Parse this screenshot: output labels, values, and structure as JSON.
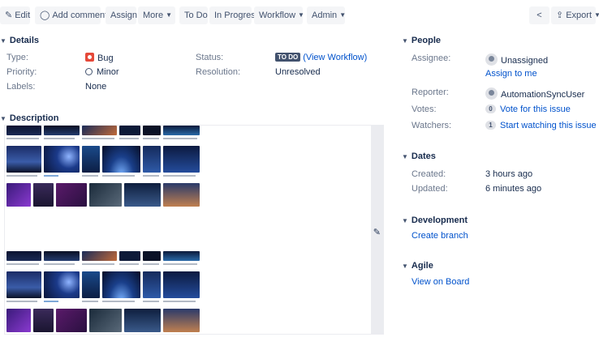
{
  "toolbar": {
    "edit": "Edit",
    "add_comment": "Add comment",
    "assign": "Assign",
    "more": "More",
    "todo": "To Do",
    "in_progress": "In Progress",
    "workflow": "Workflow",
    "admin": "Admin",
    "export": "Export"
  },
  "details": {
    "heading": "Details",
    "type_label": "Type:",
    "type_value": "Bug",
    "priority_label": "Priority:",
    "priority_value": "Minor",
    "labels_label": "Labels:",
    "labels_value": "None",
    "status_label": "Status:",
    "status_lozenge": "TO DO",
    "status_link": "(View Workflow)",
    "resolution_label": "Resolution:",
    "resolution_value": "Unresolved"
  },
  "description": {
    "heading": "Description"
  },
  "people": {
    "heading": "People",
    "assignee_label": "Assignee:",
    "assignee_value": "Unassigned",
    "assign_to_me": "Assign to me",
    "reporter_label": "Reporter:",
    "reporter_value": "AutomationSyncUser",
    "votes_label": "Votes:",
    "votes_count": "0",
    "votes_link": "Vote for this issue",
    "watchers_label": "Watchers:",
    "watchers_count": "1",
    "watchers_link": "Start watching this issue"
  },
  "dates": {
    "heading": "Dates",
    "created_label": "Created:",
    "created_value": "3 hours ago",
    "updated_label": "Updated:",
    "updated_value": "6 minutes ago"
  },
  "development": {
    "heading": "Development",
    "create_branch": "Create branch"
  },
  "agile": {
    "heading": "Agile",
    "view_on_board": "View on Board"
  },
  "icons": {
    "edit": "pencil-icon",
    "comment": "speech-bubble-icon",
    "share": "share-icon",
    "export": "export-icon",
    "bug": "bug-icon",
    "minor": "minor-priority-icon"
  },
  "colors": {
    "link": "#0052cc",
    "bug": "#e5493a",
    "button_bg": "#f4f5f7",
    "lozenge": "#42526e"
  }
}
